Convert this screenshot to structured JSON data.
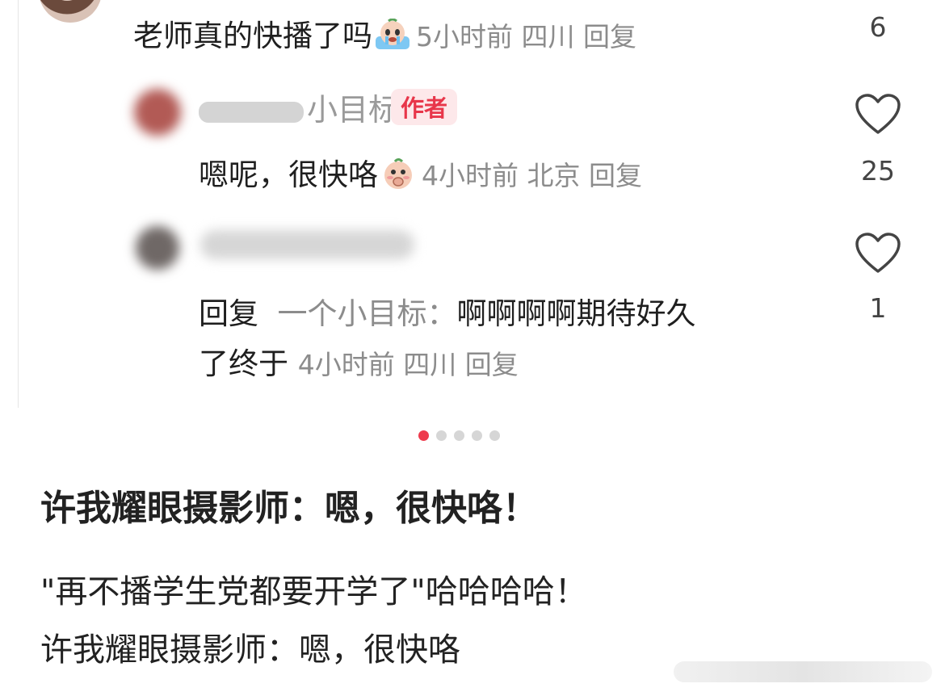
{
  "comment_top": {
    "text": "老师真的快播了吗",
    "time": "5小时前",
    "location": "四川",
    "reply_label": "回复",
    "like_count": "6",
    "emoji": "crying-emoji"
  },
  "author_reply": {
    "name_visible": "小目标",
    "badge": "作者",
    "text": "嗯呢，很快咯",
    "time": "4小时前",
    "location": "北京",
    "reply_label": "回复",
    "like_count": "25",
    "emoji": "shy-emoji"
  },
  "user_reply": {
    "reply_prefix": "回复",
    "reply_to": "一个小目标：",
    "text_line1": "啊啊啊啊期待好久",
    "text_line2": "了终于",
    "time": "4小时前",
    "location": "四川",
    "reply_label": "回复",
    "like_count": "1"
  },
  "carousel": {
    "count": 5,
    "active_index": 0
  },
  "post": {
    "title": "许我耀眼摄影师：嗯，很快咯！",
    "line1": "\"再不播学生党都要开学了\"哈哈哈哈！",
    "line2": "许我耀眼摄影师：嗯，很快咯"
  },
  "colors": {
    "accent": "#ee3b4d",
    "meta_gray": "#8c8c8c",
    "badge_bg": "#fde8ea"
  }
}
